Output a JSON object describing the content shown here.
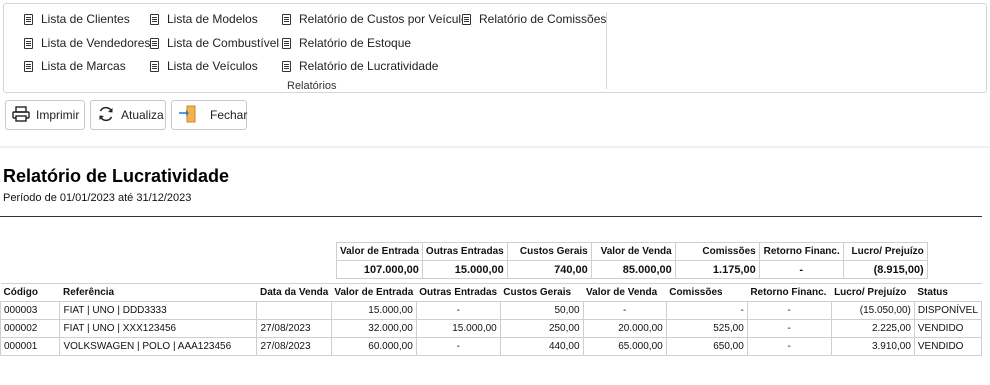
{
  "ribbon": {
    "col1": [
      "Lista de Clientes",
      "Lista de Vendedores",
      "Lista de Marcas"
    ],
    "col2": [
      "Lista de Modelos",
      "Lista de Combustível",
      "Lista de Veículos"
    ],
    "col3": [
      "Relatório de Custos por Veículo",
      "Relatório de Estoque",
      "Relatório de Lucratividade"
    ],
    "col4": [
      "Relatório de Comissões"
    ],
    "group_label": "Relatórios"
  },
  "toolbar": {
    "print_label": "Imprimir",
    "refresh_label": "Atualiza",
    "close_label": "Fechar"
  },
  "report": {
    "title": "Relatório de Lucratividade",
    "period": "Período de 01/01/2023 até 31/12/2023",
    "summary_headers": [
      "Valor de Entrada",
      "Outras Entradas",
      "Custos Gerais",
      "Valor de Venda",
      "Comissões",
      "Retorno Financ.",
      "Lucro/ Prejuízo"
    ],
    "summary_values": [
      "107.000,00",
      "15.000,00",
      "740,00",
      "85.000,00",
      "1.175,00",
      "-",
      "(8.915,00)"
    ],
    "columns": [
      "Código",
      "Referência",
      "Data da Venda",
      "Valor de Entrada",
      "Outras Entradas",
      "Custos Gerais",
      "Valor de Venda",
      "Comissões",
      "Retorno Financ.",
      "Lucro/ Prejuízo",
      "Status"
    ],
    "rows": [
      [
        "000003",
        "FIAT | UNO | DDD3333",
        "",
        "15.000,00",
        "-",
        "50,00",
        "-",
        "-",
        "-",
        "(15.050,00)",
        "DISPONÍVEL"
      ],
      [
        "000002",
        "FIAT | UNO | XXX123456",
        "27/08/2023",
        "32.000,00",
        "15.000,00",
        "250,00",
        "20.000,00",
        "525,00",
        "-",
        "2.225,00",
        "VENDIDO"
      ],
      [
        "000001",
        "VOLKSWAGEN | POLO | AAA123456",
        "27/08/2023",
        "60.000,00",
        "-",
        "440,00",
        "65.000,00",
        "650,00",
        "-",
        "3.910,00",
        "VENDIDO"
      ]
    ]
  }
}
